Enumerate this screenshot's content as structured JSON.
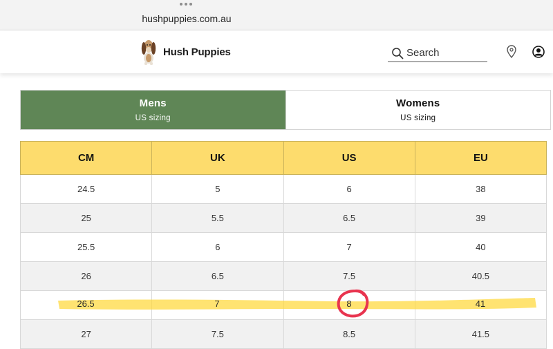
{
  "browser": {
    "url": "hushpuppies.com.au"
  },
  "header": {
    "brand": "Hush Puppies",
    "search_placeholder": "Search",
    "logo_icon": "basset-hound-logo-icon",
    "search_icon": "search-icon",
    "location_icon": "location-pin-icon",
    "account_icon": "user-account-icon"
  },
  "tabs": [
    {
      "label": "Mens",
      "sub": "US sizing",
      "active": true
    },
    {
      "label": "Womens",
      "sub": "US sizing",
      "active": false
    }
  ],
  "table": {
    "headers": [
      "CM",
      "UK",
      "US",
      "EU"
    ],
    "rows": [
      [
        "24.5",
        "5",
        "6",
        "38"
      ],
      [
        "25",
        "5.5",
        "6.5",
        "39"
      ],
      [
        "25.5",
        "6",
        "7",
        "40"
      ],
      [
        "26",
        "6.5",
        "7.5",
        "40.5"
      ],
      [
        "26.5",
        "7",
        "8",
        "41"
      ],
      [
        "27",
        "7.5",
        "8.5",
        "41.5"
      ]
    ],
    "highlighted_row_index": 4,
    "circled_cell": "US"
  },
  "colors": {
    "active_tab": "#5f8656",
    "header_row": "#fddc6d",
    "highlighter": "#ffd83a",
    "circle": "#e8344f"
  }
}
